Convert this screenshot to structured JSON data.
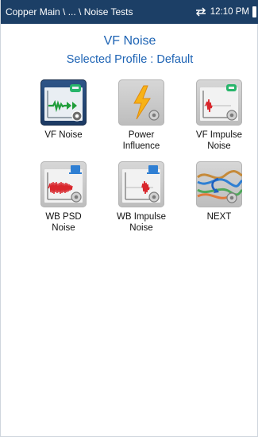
{
  "topbar": {
    "breadcrumb": "Copper Main \\ ... \\ Noise Tests",
    "time": "12:10 PM"
  },
  "header": {
    "title": "VF Noise",
    "subtitle": "Selected Profile : Default"
  },
  "tiles": [
    {
      "label_line1": "VF Noise",
      "label_line2": "",
      "icon": "vf-noise-icon",
      "selected": true
    },
    {
      "label_line1": "Power",
      "label_line2": "Influence",
      "icon": "power-influence-icon",
      "selected": false
    },
    {
      "label_line1": "VF Impulse",
      "label_line2": "Noise",
      "icon": "vf-impulse-noise-icon",
      "selected": false
    },
    {
      "label_line1": "WB PSD",
      "label_line2": "Noise",
      "icon": "wb-psd-noise-icon",
      "selected": false
    },
    {
      "label_line1": "WB Impulse",
      "label_line2": "Noise",
      "icon": "wb-impulse-noise-icon",
      "selected": false
    },
    {
      "label_line1": "NEXT",
      "label_line2": "",
      "icon": "next-icon",
      "selected": false
    }
  ],
  "colors": {
    "topbar": "#1c3f66",
    "accent_blue": "#1d63b4",
    "tile_gray": "#c8c8c8",
    "tile_selected": "#1f3f6b"
  }
}
